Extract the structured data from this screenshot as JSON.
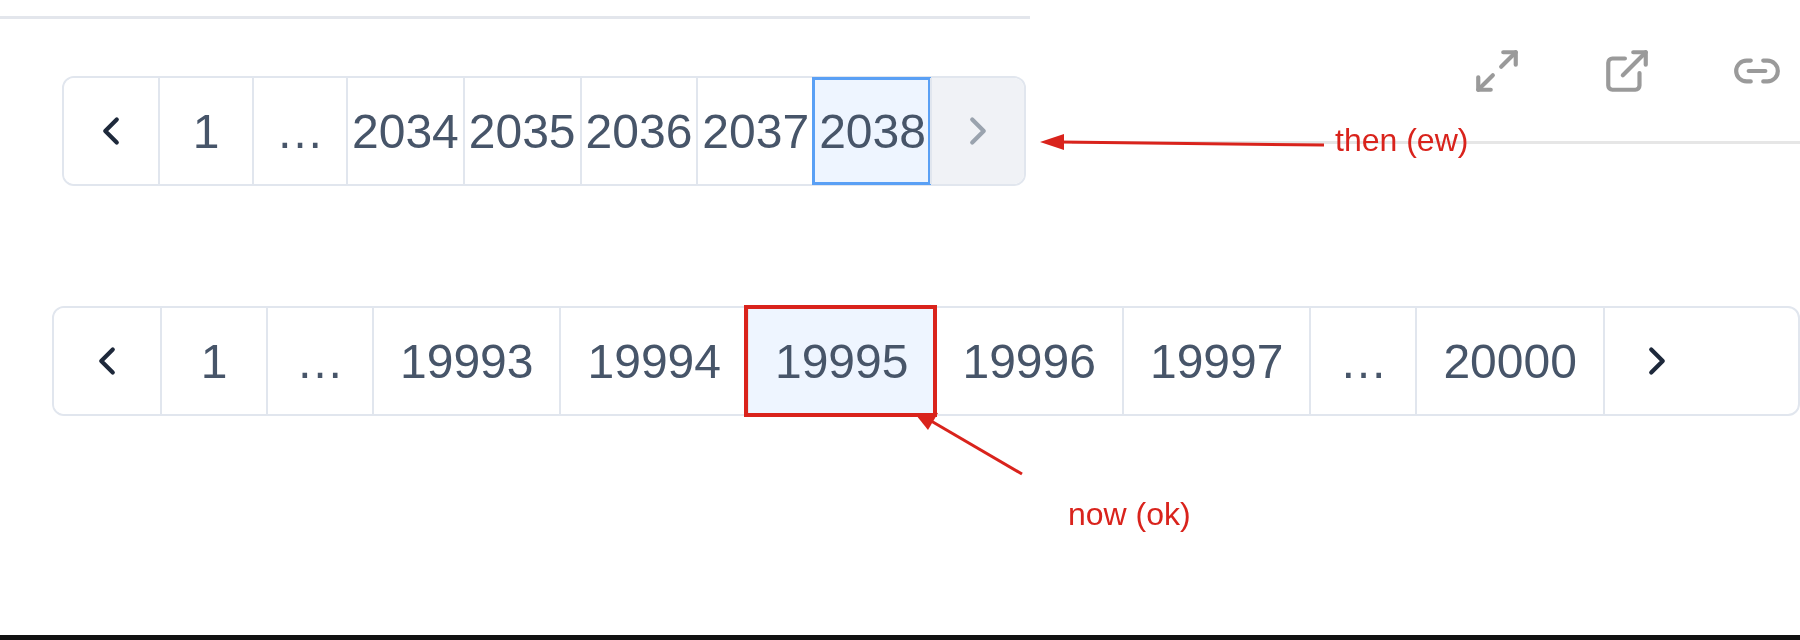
{
  "top_pagination": {
    "items": [
      {
        "kind": "prev",
        "selected": false,
        "disabled": false
      },
      {
        "kind": "page",
        "label": "1",
        "selected": false,
        "disabled": false
      },
      {
        "kind": "ellipsis",
        "label": "…",
        "selected": false,
        "disabled": false
      },
      {
        "kind": "page",
        "label": "2034",
        "selected": false,
        "disabled": false
      },
      {
        "kind": "page",
        "label": "2035",
        "selected": false,
        "disabled": false
      },
      {
        "kind": "page",
        "label": "2036",
        "selected": false,
        "disabled": false
      },
      {
        "kind": "page",
        "label": "2037",
        "selected": false,
        "disabled": false
      },
      {
        "kind": "page",
        "label": "2038",
        "selected": true,
        "disabled": false
      },
      {
        "kind": "next",
        "selected": false,
        "disabled": true
      }
    ]
  },
  "toolbar": {
    "icons": [
      {
        "kind": "expand"
      },
      {
        "kind": "external"
      },
      {
        "kind": "link"
      }
    ]
  },
  "top_annotation": {
    "text": "then (ew)"
  },
  "bottom_pagination": {
    "items": [
      {
        "kind": "prev",
        "selected": false,
        "disabled": false,
        "highlighted": false
      },
      {
        "kind": "page",
        "label": "1",
        "selected": false,
        "disabled": false,
        "highlighted": false
      },
      {
        "kind": "ellipsis",
        "label": "…",
        "selected": false,
        "disabled": false,
        "highlighted": false
      },
      {
        "kind": "page",
        "label": "19993",
        "selected": false,
        "disabled": false,
        "highlighted": false
      },
      {
        "kind": "page",
        "label": "19994",
        "selected": false,
        "disabled": false,
        "highlighted": false
      },
      {
        "kind": "page",
        "label": "19995",
        "selected": true,
        "disabled": false,
        "highlighted": true
      },
      {
        "kind": "page",
        "label": "19996",
        "selected": false,
        "disabled": false,
        "highlighted": false
      },
      {
        "kind": "page",
        "label": "19997",
        "selected": false,
        "disabled": false,
        "highlighted": false
      },
      {
        "kind": "ellipsis",
        "label": "…",
        "selected": false,
        "disabled": false,
        "highlighted": false
      },
      {
        "kind": "page",
        "label": "20000",
        "selected": false,
        "disabled": false,
        "highlighted": false
      },
      {
        "kind": "next",
        "selected": false,
        "disabled": false,
        "highlighted": false
      }
    ]
  },
  "bottom_annotation": {
    "text": "now (ok)"
  }
}
